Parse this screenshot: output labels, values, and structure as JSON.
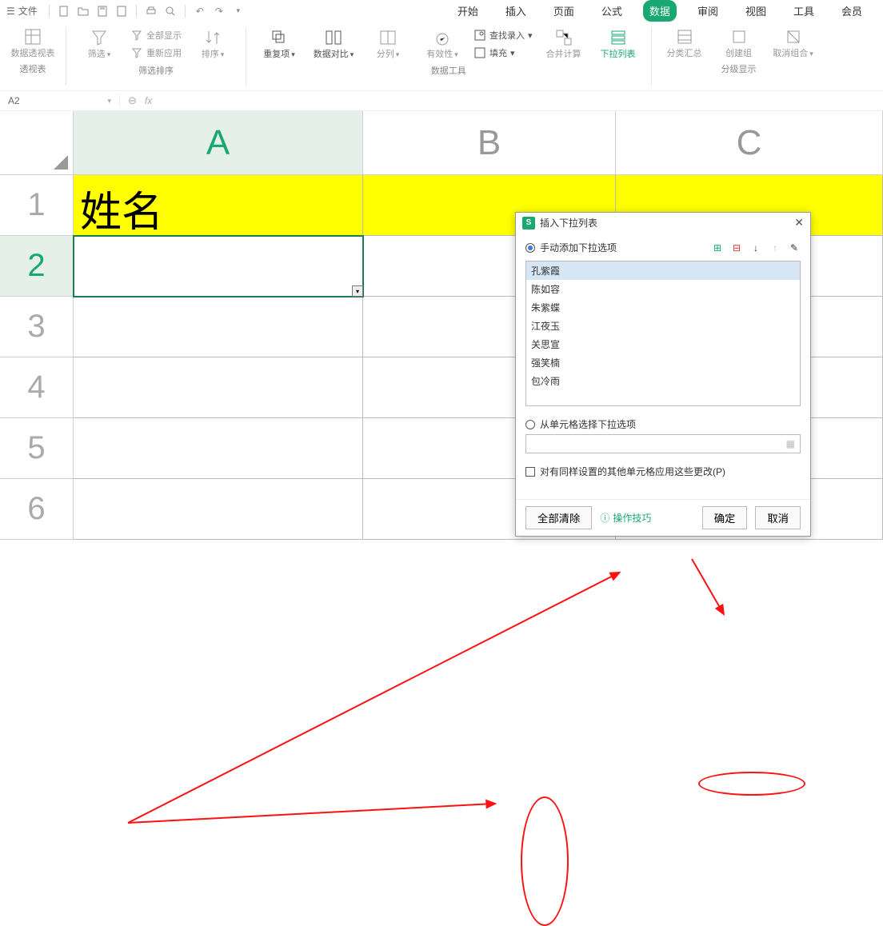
{
  "filebar": {
    "menu": "文件"
  },
  "tabs": [
    "开始",
    "插入",
    "页面",
    "公式",
    "数据",
    "审阅",
    "视图",
    "工具",
    "会员"
  ],
  "active_tab_index": 4,
  "ribbon": {
    "pivot": {
      "label": "数据透视表",
      "group": "透视表"
    },
    "filter": {
      "btn": "筛选",
      "all": "全部显示",
      "reapply": "重新应用",
      "sort": "排序",
      "group": "筛选排序"
    },
    "dup": {
      "label": "重复项"
    },
    "compare": {
      "label": "数据对比"
    },
    "split": {
      "label": "分列"
    },
    "valid": {
      "label": "有效性"
    },
    "fill": {
      "label": "填充"
    },
    "find": {
      "label": "查找录入"
    },
    "merge": {
      "label": "合并计算"
    },
    "dropdown": {
      "label": "下拉列表"
    },
    "subtotal": {
      "label": "分类汇总"
    },
    "groupcreate": {
      "label": "创建组"
    },
    "ungroup": {
      "label": "取消组合"
    },
    "datagrp": "数据工具",
    "outlinegrp": "分级显示"
  },
  "namebox": {
    "ref": "A2"
  },
  "columns": [
    "A",
    "B",
    "C"
  ],
  "rows": [
    "1",
    "2",
    "3",
    "4",
    "5",
    "6"
  ],
  "cellA1": "姓名",
  "dialog": {
    "title": "插入下拉列表",
    "opt_manual": "手动添加下拉选项",
    "opt_range": "从单元格选择下拉选项",
    "items": [
      "孔紫霞",
      "陈如容",
      "朱紫蝶",
      "江夜玉",
      "关思宣",
      "强笑楠",
      "包冷雨"
    ],
    "apply_same": "对有同样设置的其他单元格应用这些更改(P)",
    "clear": "全部清除",
    "tips": "操作技巧",
    "ok": "确定",
    "cancel": "取消"
  }
}
